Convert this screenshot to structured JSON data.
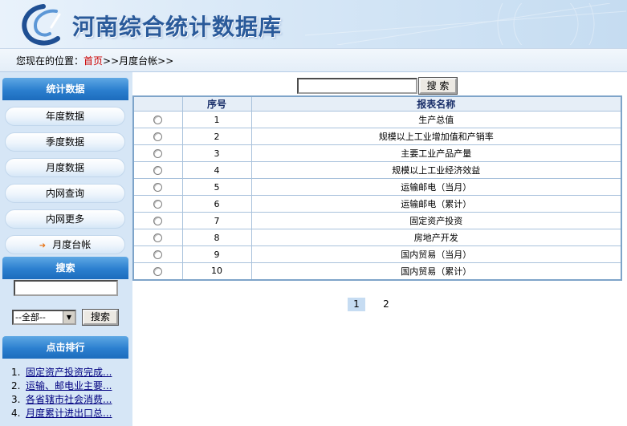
{
  "header": {
    "title": "河南综合统计数据库"
  },
  "breadcrumb": {
    "prefix": "您现在的位置：",
    "home": "首页",
    "rest": ">>月度台帐>>"
  },
  "sidebar": {
    "section1_title": "统计数据",
    "nav": [
      "年度数据",
      "季度数据",
      "月度数据",
      "内网查询",
      "内网更多",
      "月度台帐"
    ],
    "section2_title": "搜索",
    "search_value": "",
    "select_value": "--全部--",
    "search_button": "搜索",
    "section3_title": "点击排行",
    "rank": [
      {
        "num": "1.",
        "text": "固定资产投资完成..."
      },
      {
        "num": "2.",
        "text": "运输、邮电业主要..."
      },
      {
        "num": "3.",
        "text": "各省辖市社会消费..."
      },
      {
        "num": "4.",
        "text": "月度累计进出口总..."
      }
    ]
  },
  "main": {
    "search_value": "",
    "search_button": "搜 索",
    "columns": [
      "",
      "序号",
      "报表名称"
    ],
    "rows": [
      {
        "no": "1",
        "name": "生产总值"
      },
      {
        "no": "2",
        "name": "规模以上工业增加值和产销率"
      },
      {
        "no": "3",
        "name": "主要工业产品产量"
      },
      {
        "no": "4",
        "name": "规模以上工业经济效益"
      },
      {
        "no": "5",
        "name": "运输邮电（当月）"
      },
      {
        "no": "6",
        "name": "运输邮电（累计）"
      },
      {
        "no": "7",
        "name": "固定资产投资"
      },
      {
        "no": "8",
        "name": "房地产开发"
      },
      {
        "no": "9",
        "name": "国内贸易（当月）"
      },
      {
        "no": "10",
        "name": "国内贸易（累计）"
      }
    ],
    "pages": [
      "1",
      "2"
    ],
    "current_page": "1"
  },
  "colors": {
    "title": "#2a5a9a",
    "side_head": "#2b7fcf",
    "sidebar_bg": "#d6e6f6",
    "table_border": "#7ea4c9",
    "breadcrumb_home": "#cc0000",
    "rank_link": "#000080"
  }
}
